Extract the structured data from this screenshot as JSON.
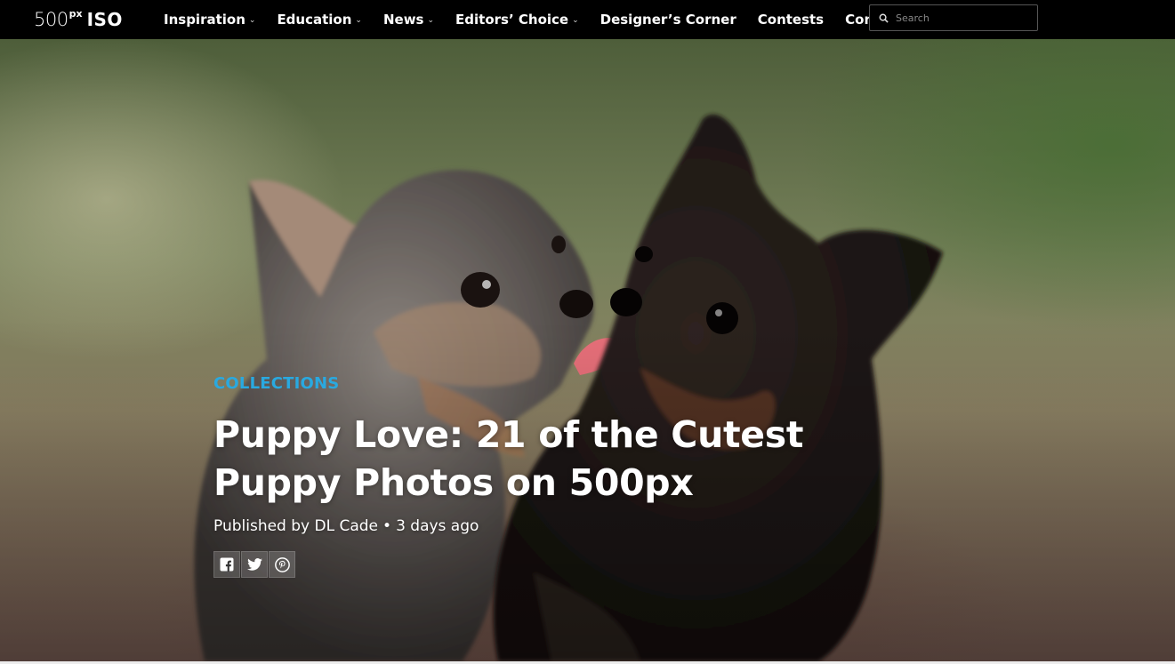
{
  "brand": {
    "logo_number": "500",
    "logo_superscript": "px",
    "logo_suffix": "ISO"
  },
  "nav": {
    "items": [
      {
        "label": "Inspiration",
        "has_dropdown": true
      },
      {
        "label": "Education",
        "has_dropdown": true
      },
      {
        "label": "News",
        "has_dropdown": true
      },
      {
        "label": "Editors’ Choice",
        "has_dropdown": true
      },
      {
        "label": "Designer’s Corner",
        "has_dropdown": false
      },
      {
        "label": "Contests",
        "has_dropdown": false
      },
      {
        "label": "Contact Us",
        "has_dropdown": false
      }
    ],
    "caret_icon": "chevron-down-icon"
  },
  "search": {
    "placeholder": "Search",
    "icon": "search-icon"
  },
  "hero": {
    "category": "COLLECTIONS",
    "title": "Puppy Love: 21 of the Cutest Puppy Photos on 500px",
    "byline_prefix": "Published by",
    "author": "DL Cade",
    "separator": "•",
    "published_ago": "3 days ago"
  },
  "share": [
    {
      "name": "facebook-icon"
    },
    {
      "name": "twitter-icon"
    },
    {
      "name": "pinterest-icon"
    }
  ],
  "colors": {
    "accent": "#29a9e0",
    "nav_bg": "#000000",
    "text": "#ffffff"
  }
}
